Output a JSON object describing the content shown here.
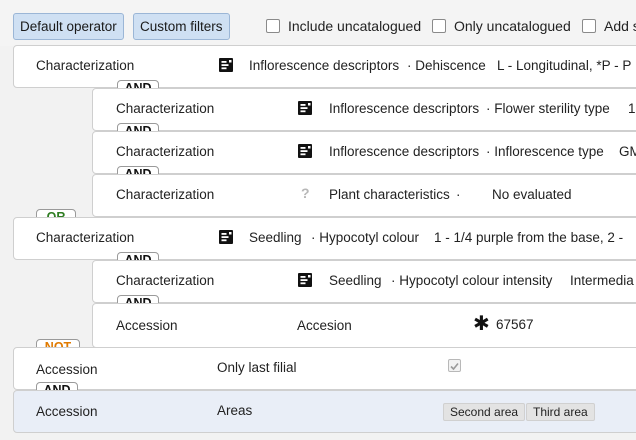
{
  "toolbar": {
    "default_operator": "Default operator",
    "custom_filters": "Custom filters",
    "include_uncatalogued": "Include uncatalogued",
    "only_uncatalogued": "Only uncatalogued",
    "add_s": "Add s"
  },
  "filters": [
    {
      "type": "Characterization",
      "descriptor": "Inflorescence descriptors",
      "field": "· Dehiscence",
      "value": "L - Longitudinal, *P - P"
    },
    {
      "op": "AND",
      "type": "Characterization",
      "descriptor": "Inflorescence descriptors",
      "field": "· Flower sterility type",
      "value": "1"
    },
    {
      "op": "AND",
      "type": "Characterization",
      "descriptor": "Inflorescence descriptors",
      "field": "· Inflorescence type",
      "value": "GM"
    },
    {
      "op": "AND",
      "type": "Characterization",
      "descriptor": "Plant characteristics",
      "field": "·",
      "value": "No evaluated"
    },
    {
      "op": "OR",
      "type": "Characterization",
      "descriptor": "Seedling",
      "field": "· Hypocotyl colour",
      "value": "1 - 1/4 purple from the base, 2 -"
    },
    {
      "op": "AND",
      "type": "Characterization",
      "descriptor": "Seedling",
      "field": "· Hypocotyl colour intensity",
      "value": "Intermedia"
    },
    {
      "op": "AND",
      "type": "Accession",
      "field": "Accesion",
      "value": "67567"
    },
    {
      "op": "NOT",
      "type": "Accession",
      "field": "Only last filial"
    },
    {
      "op": "AND",
      "type": "Accession",
      "field": "Areas",
      "tags": [
        "Second area",
        "Third area"
      ]
    }
  ],
  "icons": {
    "descriptor": "descriptor-icon",
    "unknown": "question-icon",
    "asterisk": "asterisk-icon"
  },
  "colors": {
    "button_bg": "#cfe0f3",
    "or_color": "#2f7d22",
    "not_color": "#e07a00",
    "selected_row": "#e9eef7"
  }
}
